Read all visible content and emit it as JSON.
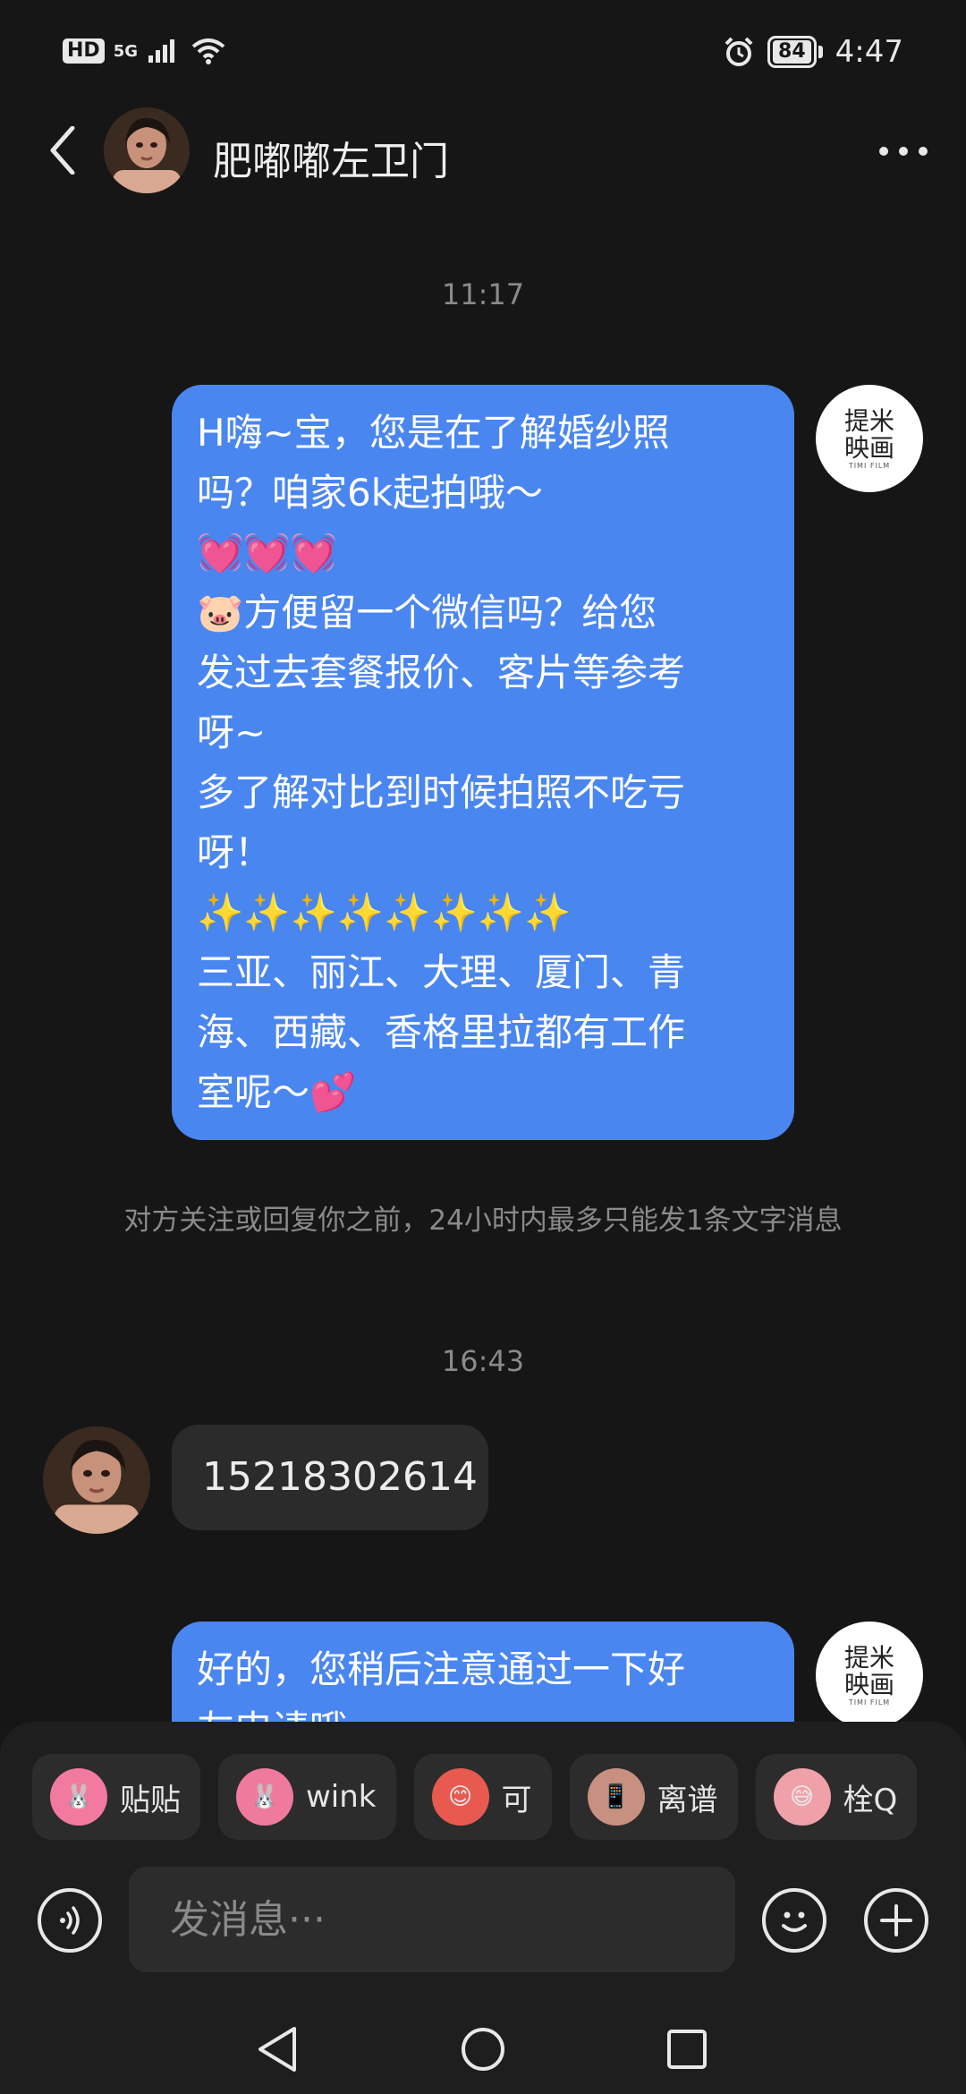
{
  "status_bar": {
    "hd": "HD",
    "network": "5G",
    "battery": "84",
    "time": "4:47"
  },
  "header": {
    "contact_name": "肥嘟嘟左卫门"
  },
  "chat": {
    "time_1": "11:17",
    "message_1_lines": [
      "H嗨~宝，您是在了解婚纱照",
      "吗？咱家6k起拍哦～",
      "💓💓💓",
      "🐷方便留一个微信吗？给您",
      "发过去套餐报价、客片等参考",
      "呀~",
      "多了解对比到时候拍照不吃亏",
      "呀！",
      "✨✨✨✨✨✨✨✨",
      "三亚、丽江、大理、厦门、青",
      "海、西藏、香格里拉都有工作",
      "室呢～💕"
    ],
    "brand_avatar": {
      "line1": "提米",
      "line2": "映画",
      "line3": "TIMI FILM"
    },
    "system_notice": "对方关注或回复你之前，24小时内最多只能发1条文字消息",
    "time_2": "16:43",
    "incoming_message": "15218302614",
    "message_2_lines": [
      "好的，您稍后注意通过一下好",
      "友申请哦"
    ]
  },
  "stickers": [
    {
      "label": "贴贴",
      "icon": "pink-bunny-sticker-icon",
      "color": "#f27aa0"
    },
    {
      "label": "wink",
      "icon": "pink-bunny-wink-sticker-icon",
      "color": "#f07a9e"
    },
    {
      "label": "可",
      "icon": "red-face-sticker-icon",
      "color": "#e85a50"
    },
    {
      "label": "离谱",
      "icon": "girl-phone-sticker-icon",
      "color": "#c89080"
    },
    {
      "label": "栓Q",
      "icon": "sweat-face-sticker-icon",
      "color": "#f0a0a8"
    }
  ],
  "composer": {
    "placeholder": "发消息···"
  }
}
